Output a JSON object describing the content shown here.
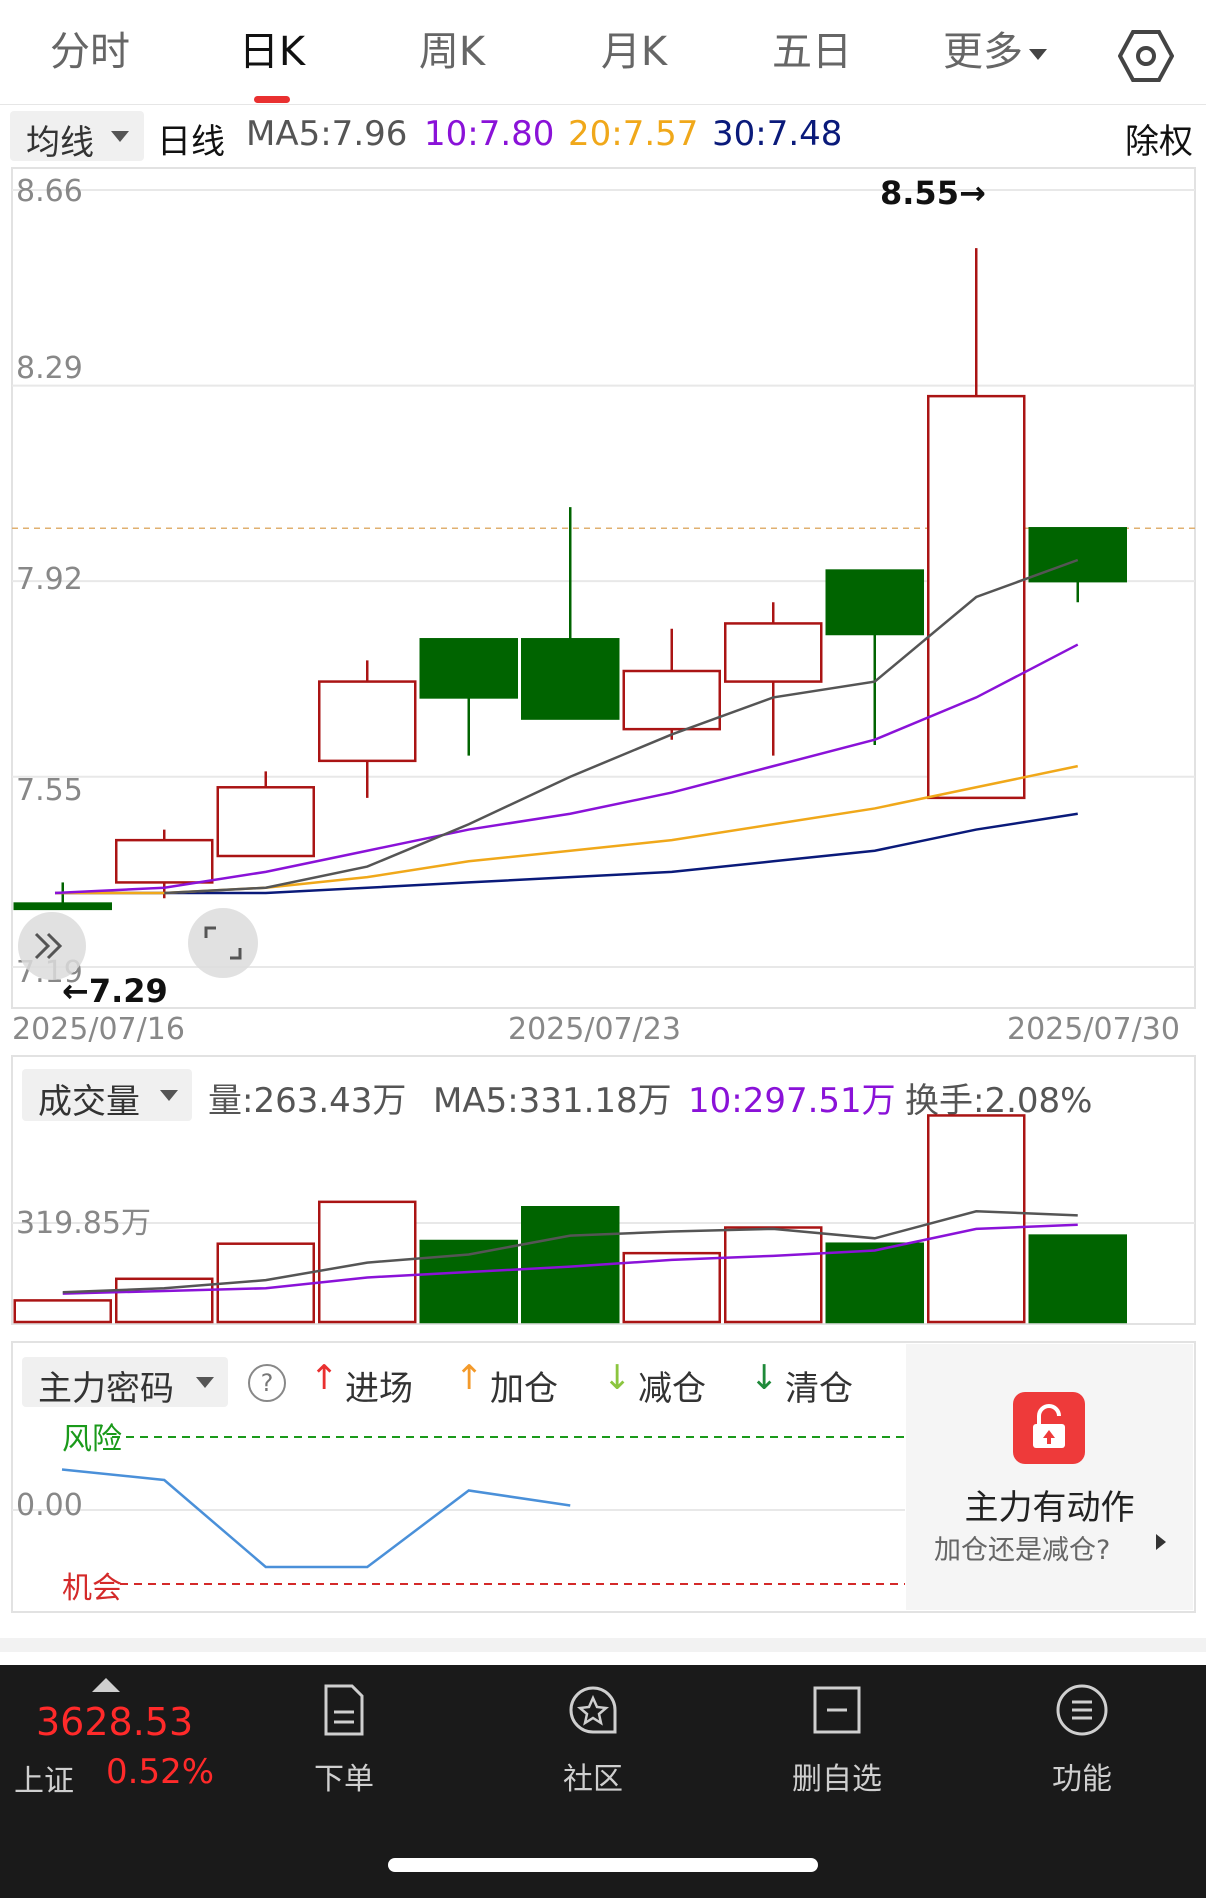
{
  "tabs": [
    {
      "label": "分时"
    },
    {
      "label": "日K"
    },
    {
      "label": "周K"
    },
    {
      "label": "月K"
    },
    {
      "label": "五日"
    },
    {
      "label": "更多"
    }
  ],
  "active_tab": "日K",
  "ma_bar": {
    "dropdown": "均线",
    "period": "日线",
    "ma5": "MA5:7.96",
    "ma10": "10:7.80",
    "ma20": "20:7.57",
    "ma30": "30:7.48",
    "adjust": "除权"
  },
  "colors": {
    "ma5": "#555555",
    "ma10": "#8a12d8",
    "ma20": "#f0a81a",
    "ma30": "#0a1a7a",
    "up": "#aa1414",
    "down": "#006400",
    "risk": "#1a9a1a",
    "chance": "#d42a2a",
    "line": "#4a90d9"
  },
  "price_axis": {
    "ticks": [
      "8.66",
      "8.29",
      "7.92",
      "7.55",
      "7.19"
    ]
  },
  "price_markers": {
    "high": "8.55→",
    "low": "←7.29"
  },
  "dates": {
    "start": "2025/07/16",
    "mid": "2025/07/23",
    "end": "2025/07/30"
  },
  "chart_data": [
    {
      "type": "candlestick",
      "title": "日K",
      "x": [
        "2025/07/16",
        "2025/07/17",
        "2025/07/18",
        "2025/07/21",
        "2025/07/22",
        "2025/07/23",
        "2025/07/24",
        "2025/07/25",
        "2025/07/28",
        "2025/07/29",
        "2025/07/30"
      ],
      "open": [
        7.31,
        7.35,
        7.4,
        7.58,
        7.81,
        7.81,
        7.64,
        7.73,
        7.94,
        7.51,
        8.02
      ],
      "close": [
        7.3,
        7.43,
        7.53,
        7.73,
        7.7,
        7.66,
        7.75,
        7.84,
        7.82,
        8.27,
        7.92
      ],
      "high": [
        7.35,
        7.45,
        7.56,
        7.77,
        7.81,
        8.06,
        7.83,
        7.88,
        7.88,
        8.55,
        8.02
      ],
      "low": [
        7.3,
        7.32,
        7.4,
        7.51,
        7.59,
        7.66,
        7.62,
        7.59,
        7.61,
        7.51,
        7.88
      ],
      "ma5": [
        7.33,
        7.34,
        7.38,
        7.46,
        7.55,
        7.63,
        7.7,
        7.73,
        7.89,
        7.96
      ],
      "ma10": [
        7.33,
        7.34,
        7.37,
        7.41,
        7.45,
        7.48,
        7.52,
        7.57,
        7.62,
        7.7,
        7.8
      ],
      "ma20": [
        7.33,
        7.33,
        7.34,
        7.36,
        7.39,
        7.41,
        7.43,
        7.46,
        7.49,
        7.53,
        7.57
      ],
      "ma30": [
        7.33,
        7.33,
        7.33,
        7.34,
        7.35,
        7.36,
        7.37,
        7.39,
        7.41,
        7.45,
        7.48
      ],
      "yticks": [
        8.66,
        8.29,
        7.92,
        7.55,
        7.19
      ],
      "ylim": [
        7.19,
        8.66
      ],
      "ref_price": 8.02
    },
    {
      "type": "bar",
      "title": "成交量",
      "categories": [
        "2025/07/16",
        "2025/07/17",
        "2025/07/18",
        "2025/07/21",
        "2025/07/22",
        "2025/07/23",
        "2025/07/24",
        "2025/07/25",
        "2025/07/28",
        "2025/07/29",
        "2025/07/30"
      ],
      "values": [
        80,
        160,
        290,
        445,
        300,
        425,
        255,
        350,
        290,
        765,
        320
      ],
      "direction": [
        "up",
        "up",
        "up",
        "up",
        "down",
        "down",
        "up",
        "up",
        "down",
        "up",
        "down"
      ],
      "ma5": [
        110,
        125,
        155,
        220,
        250,
        320,
        335,
        345,
        310,
        410,
        395
      ],
      "ma10": [
        105,
        115,
        125,
        165,
        185,
        205,
        230,
        245,
        265,
        345,
        360
      ],
      "ytick": "319.85万"
    },
    {
      "type": "line",
      "title": "主力密码",
      "values": [
        0.27,
        0.2,
        -0.38,
        -0.38,
        0.13,
        0.03
      ],
      "risk_level": 0.45,
      "chance_level": -0.55
    }
  ],
  "volume_bar": {
    "dropdown": "成交量",
    "vol": "量:263.43万",
    "ma5": "MA5:331.18万",
    "ma10": "10:297.51万",
    "turnover": "换手:2.08%"
  },
  "main_force": {
    "dropdown": "主力密码",
    "help": "?",
    "legend": [
      {
        "label": "进场",
        "icon": "up-arrow-red"
      },
      {
        "label": "加仓",
        "icon": "up-arrow-orange"
      },
      {
        "label": "减仓",
        "icon": "down-arrow-lightgreen"
      },
      {
        "label": "清仓",
        "icon": "down-arrow-green"
      }
    ],
    "risk": "风险",
    "chance": "机会",
    "zero": "0.00"
  },
  "promo": {
    "title": "主力有动作",
    "subtitle": "加仓还是减仓?",
    "icon": "lock-icon"
  },
  "index": {
    "value": "3628.53",
    "name": "上证",
    "change": "0.52%"
  },
  "nav": [
    {
      "label": "下单",
      "icon": "order-icon"
    },
    {
      "label": "社区",
      "icon": "community-icon"
    },
    {
      "label": "删自选",
      "icon": "remove-watchlist-icon"
    },
    {
      "label": "功能",
      "icon": "menu-icon"
    }
  ]
}
